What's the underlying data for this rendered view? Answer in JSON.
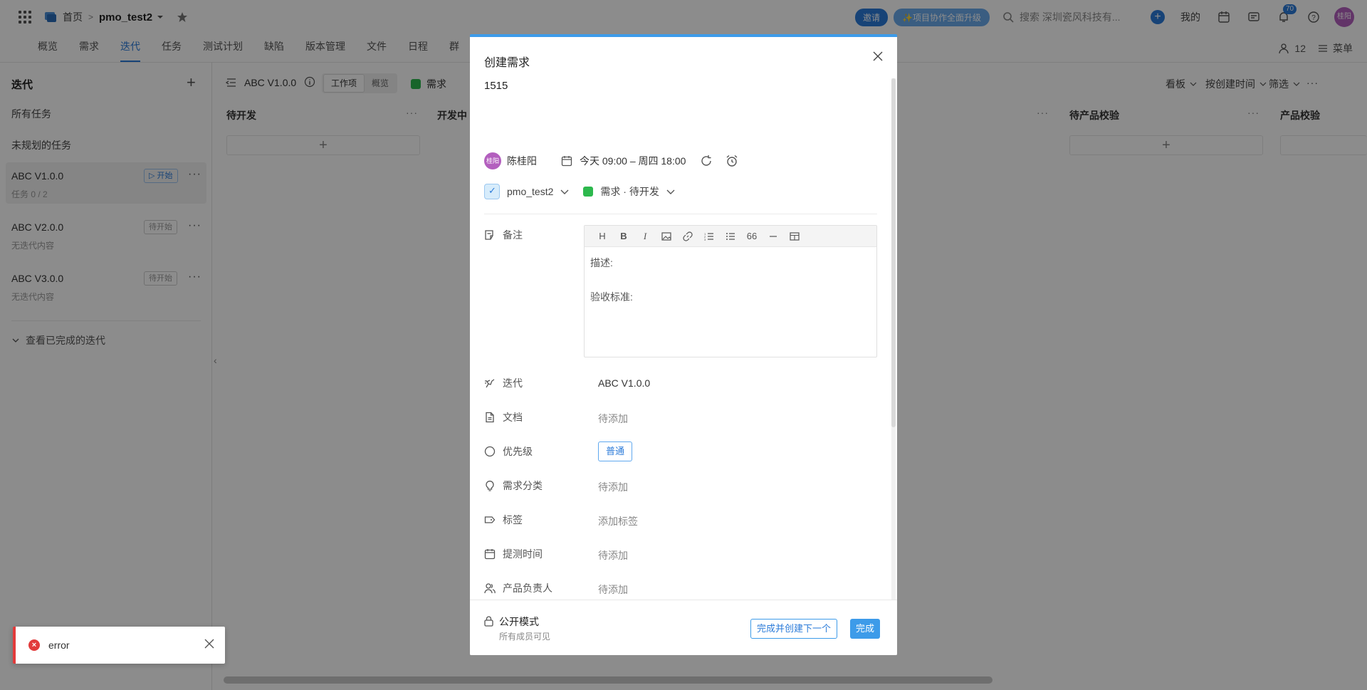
{
  "topbar": {
    "home": "首页",
    "project": "pmo_test2",
    "invite": "邀请",
    "promo": "✨项目协作全面升级",
    "search_placeholder": "搜索 深圳瓷风科技有...",
    "mine": "我的",
    "notif_count": "70",
    "avatar_text": "桂阳"
  },
  "tabs": [
    {
      "label": "概览"
    },
    {
      "label": "需求"
    },
    {
      "label": "迭代"
    },
    {
      "label": "任务"
    },
    {
      "label": "测试计划"
    },
    {
      "label": "缺陷"
    },
    {
      "label": "版本管理"
    },
    {
      "label": "文件"
    },
    {
      "label": "日程"
    },
    {
      "label": "群"
    }
  ],
  "tab_right": {
    "member_count": "12",
    "menu": "菜单"
  },
  "sidebar": {
    "title": "迭代",
    "all_tasks": "所有任务",
    "unplanned": "未规划的任务",
    "iterations": [
      {
        "name": "ABC V1.0.0",
        "sub": "任务 0 / 2",
        "status": "▷ 开始"
      },
      {
        "name": "ABC V2.0.0",
        "sub": "无迭代内容",
        "status": "待开始"
      },
      {
        "name": "ABC V3.0.0",
        "sub": "无迭代内容",
        "status": "待开始"
      }
    ],
    "view_done": "查看已完成的迭代"
  },
  "board": {
    "iteration": "ABC V1.0.0",
    "seg_work": "工作项",
    "seg_overview": "概览",
    "type": "需求",
    "kanban": "看板",
    "sort": "按创建时间",
    "filter": "筛选",
    "columns": [
      "待开发",
      "开发中",
      "待产品校验",
      "产品校验"
    ]
  },
  "modal": {
    "title": "创建需求",
    "name_value": "1515",
    "assignee": "陈桂阳",
    "assignee_avatar": "桂阳",
    "date_range": "今天 09:00  –  周四 18:00",
    "project": "pmo_test2",
    "status": "需求 · 待开发",
    "fields": {
      "remark_label": "备注",
      "iteration_label": "迭代",
      "iteration_value": "ABC V1.0.0",
      "doc_label": "文档",
      "doc_value": "待添加",
      "priority_label": "优先级",
      "priority_value": "普通",
      "category_label": "需求分类",
      "category_value": "待添加",
      "tag_label": "标签",
      "tag_value": "添加标签",
      "test_time_label": "提测时间",
      "test_time_value": "待添加",
      "owner_label": "产品负责人",
      "owner_value": "待添加"
    },
    "editor": {
      "line1": "描述:",
      "line2": "验收标准:"
    },
    "footer": {
      "mode": "公开模式",
      "mode_sub": "所有成员可见",
      "next_button": "完成并创建下一个",
      "done_button": "完成"
    }
  },
  "toast": {
    "message": "error"
  },
  "colors": {
    "accent": "#3d9be9",
    "error": "#e23b3b",
    "status_green": "#2db84d"
  }
}
